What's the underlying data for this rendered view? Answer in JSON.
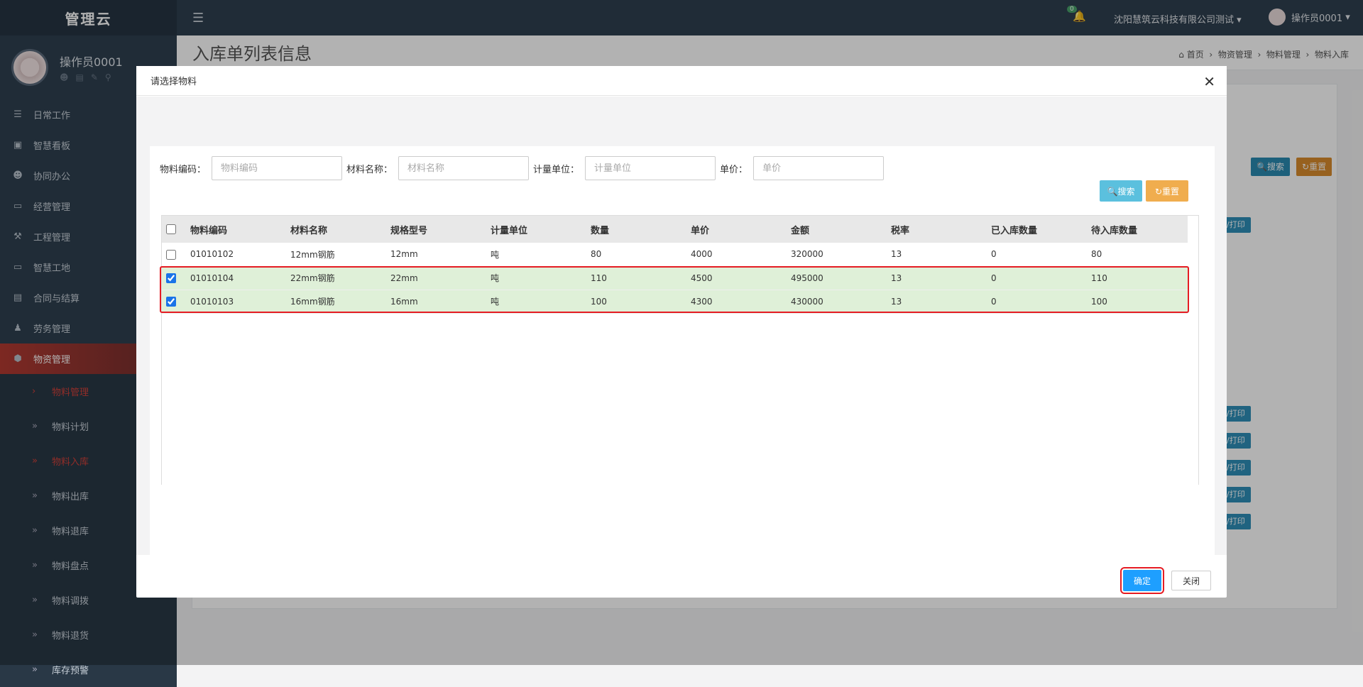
{
  "sidebar": {
    "brand": "管理云",
    "user_name": "操作员0001",
    "menu": [
      {
        "label": "日常工作",
        "icon": "list-icon"
      },
      {
        "label": "智慧看板",
        "icon": "board-icon"
      },
      {
        "label": "协同办公",
        "icon": "users-icon"
      },
      {
        "label": "经营管理",
        "icon": "desktop-icon"
      },
      {
        "label": "工程管理",
        "icon": "hammer-icon"
      },
      {
        "label": "智慧工地",
        "icon": "desktop-icon"
      },
      {
        "label": "合同与结算",
        "icon": "file-icon"
      },
      {
        "label": "劳务管理",
        "icon": "worker-icon"
      },
      {
        "label": "物资管理",
        "icon": "cube-icon"
      }
    ],
    "submenu": [
      "物料管理",
      "物料计划",
      "物料入库",
      "物料出库",
      "物料退库",
      "物料盘点",
      "物料调拨",
      "物料退货",
      "库存预警"
    ]
  },
  "topbar": {
    "notification_count": "0",
    "company": "沈阳慧筑云科技有限公司测试",
    "user": "操作员0001"
  },
  "page": {
    "title": "入库单列表信息",
    "breadcrumb": [
      "首页",
      "物资管理",
      "物料管理",
      "物料入库"
    ],
    "bg_search": "搜索",
    "bg_reset": "重置",
    "bg_tag": "/打印"
  },
  "modal": {
    "title": "请选择物料",
    "filters": [
      {
        "label": "物料编码：",
        "placeholder": "物料编码"
      },
      {
        "label": "材料名称：",
        "placeholder": "材料名称"
      },
      {
        "label": "计量单位：",
        "placeholder": "计量单位"
      },
      {
        "label": "单价：",
        "placeholder": "单价"
      }
    ],
    "search_label": "搜索",
    "reset_label": "重置",
    "columns": [
      "物料编码",
      "材料名称",
      "规格型号",
      "计量单位",
      "数量",
      "单价",
      "金额",
      "税率",
      "已入库数量",
      "待入库数量"
    ],
    "rows": [
      {
        "checked": false,
        "cells": [
          "01010102",
          "12mm钢筋",
          "12mm",
          "吨",
          "80",
          "4000",
          "320000",
          "13",
          "0",
          "80"
        ]
      },
      {
        "checked": true,
        "cells": [
          "01010104",
          "22mm钢筋",
          "22mm",
          "吨",
          "110",
          "4500",
          "495000",
          "13",
          "0",
          "110"
        ]
      },
      {
        "checked": true,
        "cells": [
          "01010103",
          "16mm钢筋",
          "16mm",
          "吨",
          "100",
          "4300",
          "430000",
          "13",
          "0",
          "100"
        ]
      }
    ],
    "confirm_label": "确定",
    "close_label": "关闭"
  }
}
